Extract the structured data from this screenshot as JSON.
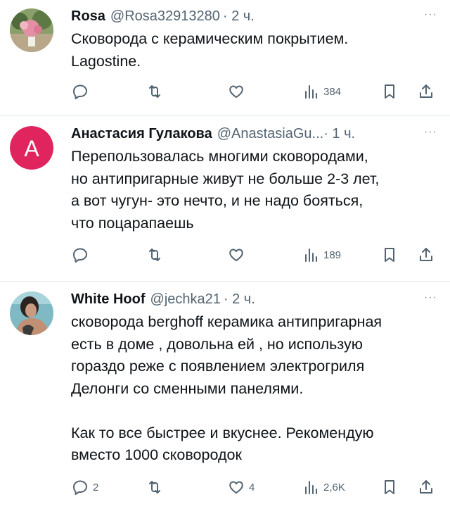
{
  "tweets": [
    {
      "name": "Rosa",
      "handle": "@Rosa32913280",
      "time": "· 2 ч.",
      "text": "Сковорода с керамическим покрытием.\nLagostine.",
      "reply_count": "",
      "like_count": "",
      "views": "384",
      "avatar_letter": ""
    },
    {
      "name": "Анастасия Гулакова",
      "handle": "@AnastasiaGu...",
      "time": "· 1 ч.",
      "text": "Перепользовалась многими сковородами,\nно антипригарные живут не больше 2-3 лет,\nа вот чугун- это нечто, и не надо бояться,\nчто поцарапаешь",
      "reply_count": "",
      "like_count": "",
      "views": "189",
      "avatar_letter": "A"
    },
    {
      "name": "White Hoof",
      "handle": "@jechka21",
      "time": "· 2 ч.",
      "text": "сковорода berghoff керамика антипригарная\nесть в доме , довольна ей , но использую\nгораздо реже с появлением электрогриля\nДелонги со сменными панелями.\n\nКак то все быстрее и вкуснее. Рекомендую\nвместо 1000 сковородок",
      "reply_count": "2",
      "like_count": "4",
      "views": "2,6K",
      "avatar_letter": ""
    }
  ],
  "more_label": "···",
  "colors": {
    "text": "#0f1419",
    "secondary": "#536471",
    "divider": "#e4e8eb",
    "avatar_a_bg": "#e0245e"
  },
  "icons": [
    "reply-icon",
    "retweet-icon",
    "like-icon",
    "views-icon",
    "bookmark-icon",
    "share-icon"
  ]
}
